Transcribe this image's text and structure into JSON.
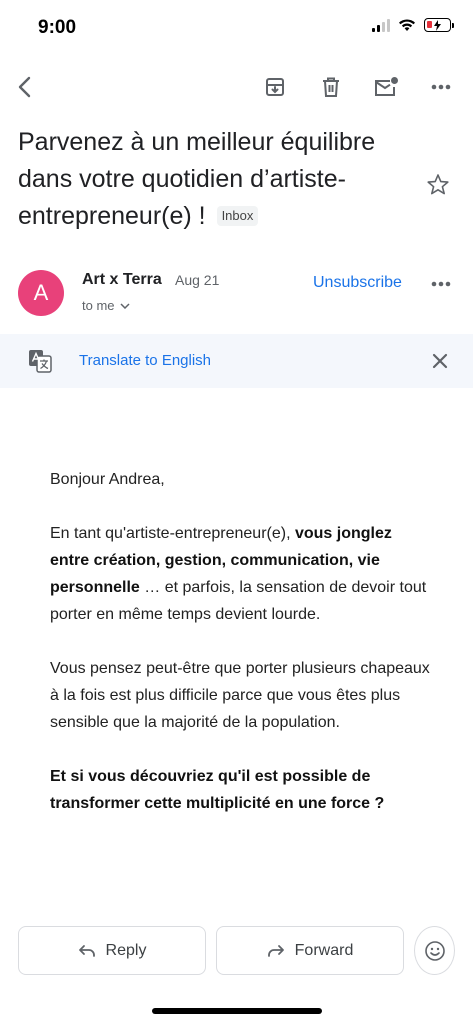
{
  "status_bar": {
    "time": "9:00"
  },
  "email": {
    "subject": "Parvenez à un meilleur équilibre dans votre quotidien d’artiste-entrepreneur(e) !",
    "label": "Inbox",
    "sender": {
      "initial": "A",
      "name": "Art x Terra",
      "date": "Aug 21",
      "recipient": "to me",
      "avatar_color": "#e8417a"
    },
    "unsubscribe_label": "Unsubscribe"
  },
  "translate_bar": {
    "label": "Translate to English"
  },
  "body": {
    "greeting": "Bonjour Andrea,",
    "p1_start": "En tant qu'artiste-entrepreneur(e), ",
    "p1_bold": "vous jonglez entre création, gestion, communication, vie personnelle",
    "p1_end": " … et parfois, la sensation de devoir tout porter en même temps devient lourde.",
    "p2": "Vous pensez peut-être que porter plusieurs chapeaux à la fois est plus difficile parce que vous êtes plus sensible que la majorité de la population.",
    "p3_bold": "Et si vous découvriez qu'il est possible de transformer cette multiplicité en une force ?"
  },
  "actions": {
    "reply_label": "Reply",
    "forward_label": "Forward"
  },
  "colors": {
    "accent": "#1a73e8",
    "translate_bg": "#f4f7fc",
    "battery_low": "#e5313b"
  },
  "icons": [
    "back-arrow-icon",
    "archive-icon",
    "trash-icon",
    "mark-unread-icon",
    "more-icon",
    "star-icon",
    "chevron-down-icon",
    "translate-icon",
    "close-icon",
    "reply-icon",
    "forward-icon",
    "emoji-icon"
  ]
}
